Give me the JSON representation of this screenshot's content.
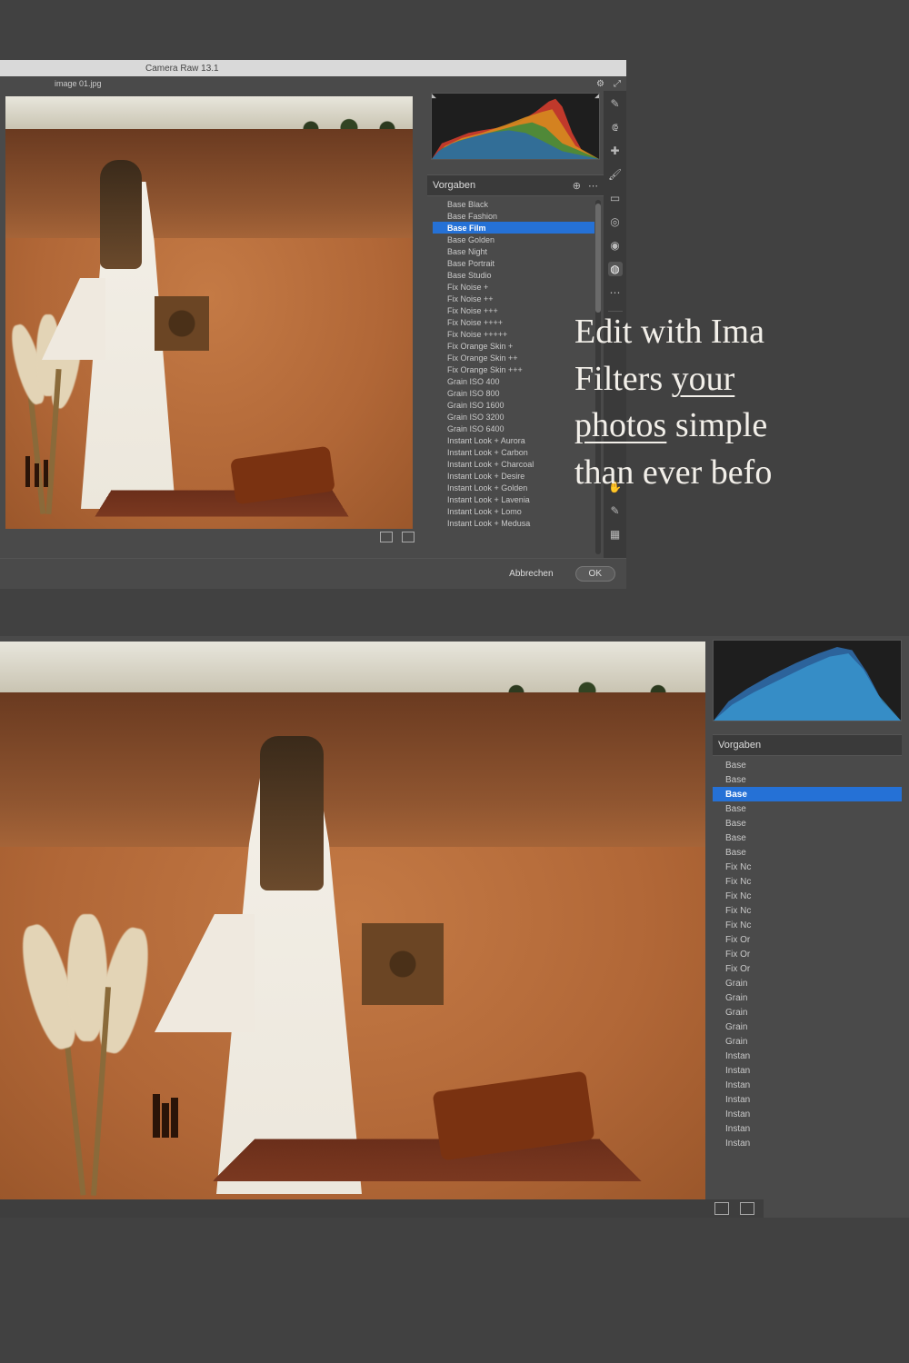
{
  "app": {
    "title": "Camera Raw 13.1",
    "filename": "image 01.jpg"
  },
  "panel": {
    "title": "Vorgaben",
    "presets": [
      "Base Black",
      "Base Fashion",
      "Base Film",
      "Base Golden",
      "Base Night",
      "Base Portrait",
      "Base Studio",
      "Fix Noise +",
      "Fix Noise ++",
      "Fix Noise +++",
      "Fix Noise ++++",
      "Fix Noise +++++",
      "Fix Orange Skin +",
      "Fix Orange Skin ++",
      "Fix Orange Skin +++",
      "Grain ISO 400",
      "Grain ISO 800",
      "Grain ISO 1600",
      "Grain ISO 3200",
      "Grain ISO 6400",
      "Instant Look + Aurora",
      "Instant Look + Carbon",
      "Instant Look + Charcoal",
      "Instant Look + Desire",
      "Instant Look + Golden",
      "Instant Look + Lavenia",
      "Instant Look + Lomo",
      "Instant Look + Medusa"
    ],
    "selected_index": 2
  },
  "bottom_panel": {
    "title": "Vorgaben",
    "presets_truncated": [
      "Base ",
      "Base ",
      "Base ",
      "Base ",
      "Base ",
      "Base ",
      "Base ",
      "Fix Nc",
      "Fix Nc",
      "Fix Nc",
      "Fix Nc",
      "Fix Nc",
      "Fix Or",
      "Fix Or",
      "Fix Or",
      "Grain",
      "Grain",
      "Grain",
      "Grain",
      "Grain",
      "Instan",
      "Instan",
      "Instan",
      "Instan",
      "Instan",
      "Instan",
      "Instan"
    ],
    "selected_index": 2
  },
  "buttons": {
    "cancel": "Abbrechen",
    "ok": "OK"
  },
  "promo": {
    "line1_a": "Edit with Ima",
    "line2_a": "Filters ",
    "line2_u": "your",
    "line3_u": "photos",
    "line3_b": " simple",
    "line4": "than ever befo"
  }
}
